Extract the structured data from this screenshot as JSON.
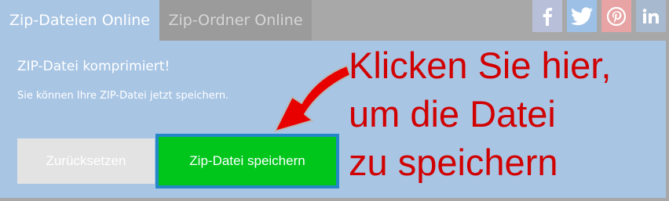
{
  "tabs": [
    {
      "label": "Zip-Dateien Online",
      "active": true
    },
    {
      "label": "Zip-Ordner Online",
      "active": false
    }
  ],
  "social": {
    "facebook": {
      "icon": "facebook-icon",
      "color": "#b8bfd8"
    },
    "twitter": {
      "icon": "twitter-icon",
      "color": "#9cc0e6"
    },
    "pinterest": {
      "icon": "pinterest-icon",
      "color": "#e8a4a4"
    },
    "linkedin": {
      "icon": "linkedin-icon",
      "color": "#a7b9cf"
    }
  },
  "status": {
    "title": "ZIP-Datei komprimiert!",
    "subtitle": "Sie können Ihre ZIP-Datei jetzt speichern."
  },
  "buttons": {
    "reset": "Zurücksetzen",
    "save": "Zip-Datei speichern"
  },
  "annotation": {
    "lines": [
      "Klicken Sie hier,",
      "um die Datei",
      "zu speichern"
    ],
    "color": "#d10000"
  },
  "colors": {
    "panel": "#a8c5e4",
    "save_button": "#00c61c",
    "save_border": "#2488c8",
    "reset_button": "#e3e3e3"
  }
}
